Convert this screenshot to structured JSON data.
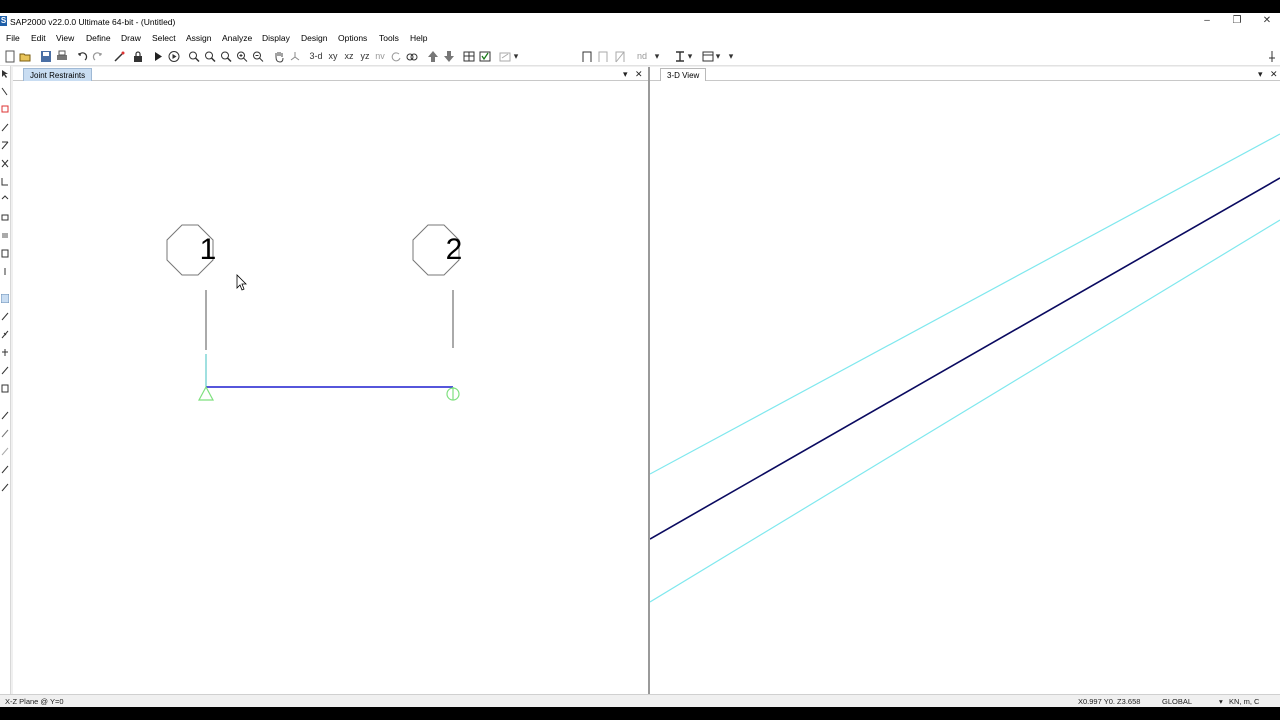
{
  "window": {
    "icon_letter": "S",
    "title": "SAP2000 v22.0.0 Ultimate 64-bit - (Untitled)",
    "minimize_glyph": "–",
    "restore_glyph": "❐",
    "close_glyph": "✕"
  },
  "menubar": {
    "items": [
      "File",
      "Edit",
      "View",
      "Define",
      "Draw",
      "Select",
      "Assign",
      "Analyze",
      "Display",
      "Design",
      "Options",
      "Tools",
      "Help"
    ]
  },
  "toolbar": {
    "view_3d": "3-d",
    "view_xy": "xy",
    "view_xz": "xz",
    "view_yz": "yz",
    "view_nv": "nv",
    "view_nd": "nd"
  },
  "left_pane": {
    "tab_label": "Joint Restraints",
    "joints": [
      {
        "label": "1",
        "restraint": "pin"
      },
      {
        "label": "2",
        "restraint": "roller"
      }
    ],
    "colors": {
      "frame": "#1e1ecf",
      "restraint": "#7fe07f",
      "axis": "#40c0c0",
      "grid": "#555555"
    }
  },
  "right_pane": {
    "tab_label": "3-D View",
    "colors": {
      "frame": "#0a0a60",
      "grid": "#7fe8ee"
    }
  },
  "pane_menu_glyph": "▾",
  "pane_close_glyph": "✕",
  "statusbar": {
    "plane": "X-Z Plane @ Y=0",
    "coordinates": "X0.997  Y0.  Z3.658",
    "coord_system": "GLOBAL",
    "units": "KN, m, C"
  }
}
